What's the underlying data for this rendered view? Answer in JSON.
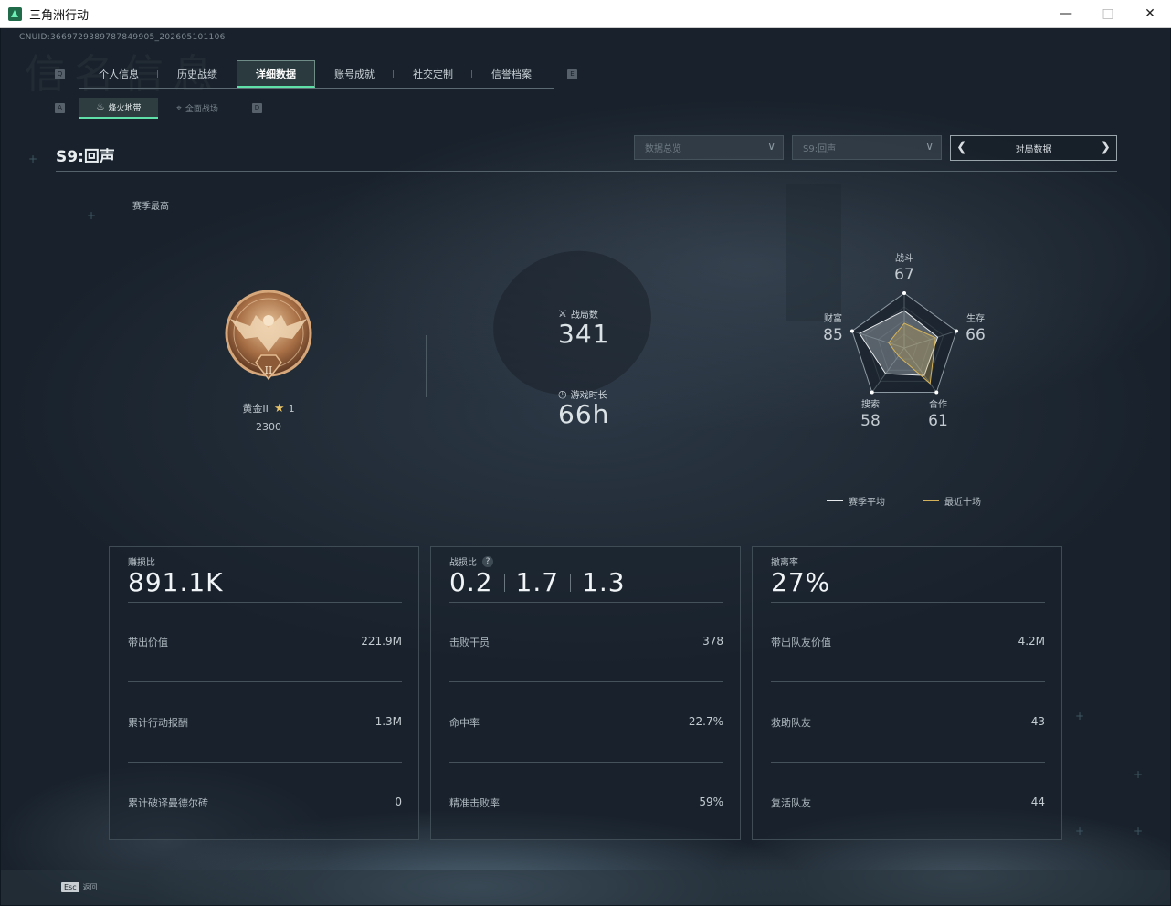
{
  "window": {
    "title": "三角洲行动"
  },
  "cnuid": "CNUID:3669729389787849905_202605101106",
  "watermark": "信名信息",
  "tabs": {
    "prev_key": "Q",
    "next_key": "E",
    "items": [
      "个人信息",
      "历史战绩",
      "详细数据",
      "账号成就",
      "社交定制",
      "信誉档案"
    ],
    "active_index": 2
  },
  "subtabs": {
    "prev_key": "A",
    "next_key": "D",
    "items": [
      {
        "label": "烽火地带",
        "icon": "flame-icon"
      },
      {
        "label": "全面战场",
        "icon": "crosshair-icon"
      }
    ],
    "active_index": 0
  },
  "season": {
    "title": "S9:回声"
  },
  "filters": {
    "overview": "数据总览",
    "season_select": "S9:回声",
    "match_data": "对局数据"
  },
  "rank": {
    "peak_label": "赛季最高",
    "name": "黄金II",
    "stars": "1",
    "points": "2300",
    "medal_numeral": "II"
  },
  "stats": {
    "matches_label": "战局数",
    "matches_value": "341",
    "playtime_label": "游戏时长",
    "playtime_value": "66h"
  },
  "radar": {
    "axes": [
      {
        "label": "战斗",
        "value": "67"
      },
      {
        "label": "生存",
        "value": "66"
      },
      {
        "label": "合作",
        "value": "61"
      },
      {
        "label": "搜索",
        "value": "58"
      },
      {
        "label": "财富",
        "value": "85"
      }
    ],
    "season_avg": [
      0.68,
      0.64,
      0.62,
      0.58,
      0.86
    ],
    "recent_ten": [
      0.45,
      0.6,
      0.8,
      0.18,
      0.3
    ],
    "legend": [
      {
        "label": "赛季平均",
        "color": "#e6eaec"
      },
      {
        "label": "最近十场",
        "color": "#d4b25a"
      }
    ]
  },
  "cards": [
    {
      "head": "赚损比",
      "big": [
        "891.1K"
      ],
      "rows": [
        {
          "label": "带出价值",
          "value": "221.9M"
        },
        {
          "label": "累计行动报酬",
          "value": "1.3M"
        },
        {
          "label": "累计破译曼德尔砖",
          "value": "0"
        }
      ]
    },
    {
      "head": "战损比",
      "help": "?",
      "big": [
        "0.2",
        "1.7",
        "1.3"
      ],
      "rows": [
        {
          "label": "击败干员",
          "value": "378"
        },
        {
          "label": "命中率",
          "value": "22.7%"
        },
        {
          "label": "精准击败率",
          "value": "59%"
        }
      ]
    },
    {
      "head": "撤离率",
      "big": [
        "27%"
      ],
      "rows": [
        {
          "label": "带出队友价值",
          "value": "4.2M"
        },
        {
          "label": "救助队友",
          "value": "43"
        },
        {
          "label": "复活队友",
          "value": "44"
        }
      ]
    }
  ],
  "bottom": {
    "esc_key": "Esc",
    "esc_label": "返回"
  }
}
